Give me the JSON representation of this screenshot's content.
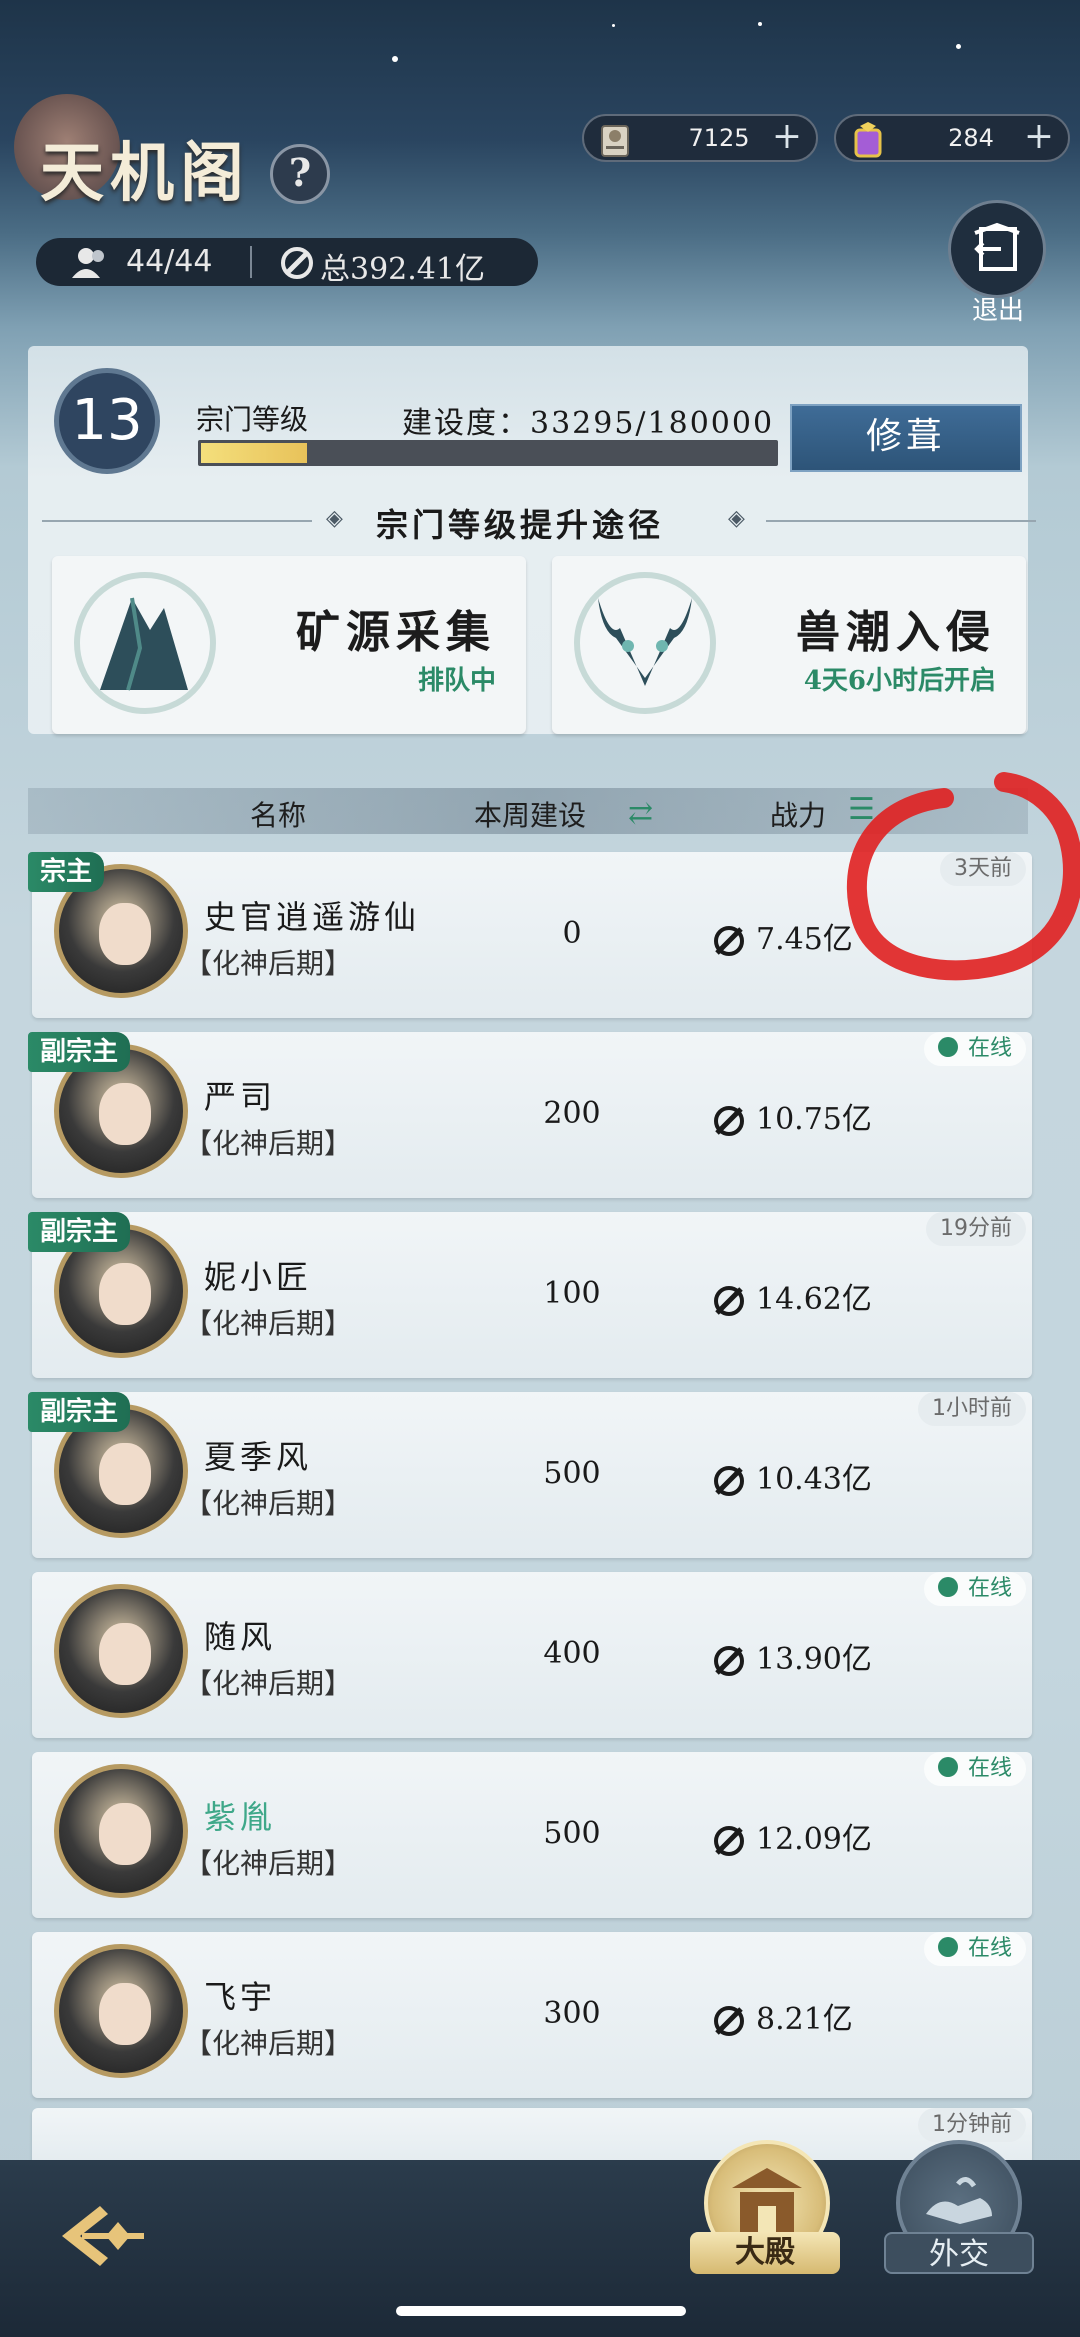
{
  "header": {
    "title": "天机阁",
    "help_icon": "?",
    "resources": [
      {
        "icon": "scroll-icon",
        "value": "7125",
        "plus": "+"
      },
      {
        "icon": "gem-icon",
        "value": "284",
        "plus": "+"
      }
    ],
    "members": "44/44",
    "total_power": "总392.41亿",
    "exit_label": "退出"
  },
  "sect": {
    "level": "13",
    "level_label": "宗门等级",
    "build_label": "建设度：33295/180000",
    "build_progress": 0.185,
    "build_button": "修葺",
    "upgrade_title": "宗门等级提升途径",
    "cards": [
      {
        "name": "矿源采集",
        "status": "排队中"
      },
      {
        "name": "兽潮入侵",
        "status": "4天6小时后开启"
      }
    ]
  },
  "table": {
    "col_name": "名称",
    "col_weekly": "本周建设",
    "col_power": "战力",
    "rows": [
      {
        "role": "宗主",
        "name": "史官逍遥游仙",
        "rank": "【化神后期】",
        "weekly": "0",
        "power": "7.45亿",
        "status": "3天前",
        "online": false
      },
      {
        "role": "副宗主",
        "name": "严司",
        "rank": "【化神后期】",
        "weekly": "200",
        "power": "10.75亿",
        "status": "在线",
        "online": true
      },
      {
        "role": "副宗主",
        "name": "妮小匠",
        "rank": "【化神后期】",
        "weekly": "100",
        "power": "14.62亿",
        "status": "19分前",
        "online": false
      },
      {
        "role": "副宗主",
        "name": "夏季风",
        "rank": "【化神后期】",
        "weekly": "500",
        "power": "10.43亿",
        "status": "1小时前",
        "online": false
      },
      {
        "role": "",
        "name": "随风",
        "rank": "【化神后期】",
        "weekly": "400",
        "power": "13.90亿",
        "status": "在线",
        "online": true
      },
      {
        "role": "",
        "name": "紫胤",
        "rank": "【化神后期】",
        "weekly": "500",
        "power": "12.09亿",
        "status": "在线",
        "online": true
      },
      {
        "role": "",
        "name": "飞宇",
        "rank": "【化神后期】",
        "weekly": "300",
        "power": "8.21亿",
        "status": "在线",
        "online": true
      }
    ],
    "partial_row_status": "1分钟前"
  },
  "nav": {
    "back_icon": "back-arrow-icon",
    "tabs": [
      {
        "label": "大殿",
        "active": true
      },
      {
        "label": "外交",
        "active": false
      }
    ]
  },
  "colors": {
    "accent_green": "#2b8a67",
    "gold": "#b69a62",
    "annotation_red": "#e02020"
  }
}
